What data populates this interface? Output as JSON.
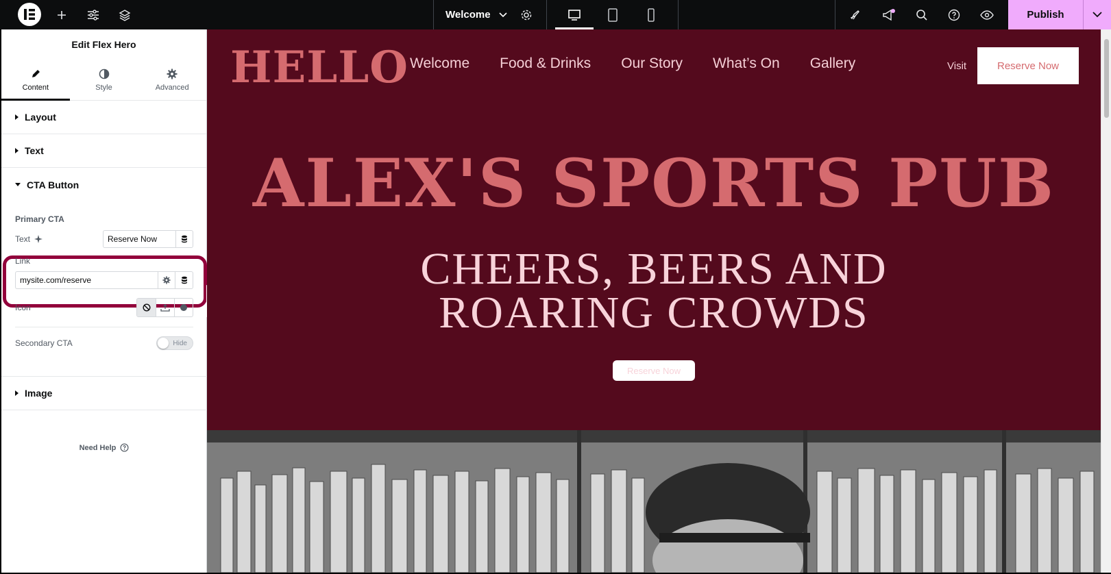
{
  "topbar": {
    "page_name": "Welcome",
    "publish_label": "Publish"
  },
  "panel": {
    "title": "Edit Flex Hero",
    "tabs": [
      {
        "label": "Content"
      },
      {
        "label": "Style"
      },
      {
        "label": "Advanced"
      }
    ],
    "sections": {
      "layout": "Layout",
      "text": "Text",
      "cta": "CTA Button",
      "image": "Image"
    },
    "primary_cta": {
      "heading": "Primary CTA",
      "text_label": "Text",
      "text_value": "Reserve Now",
      "link_label": "Link",
      "link_value": "mysite.com/reserve",
      "icon_label": "Icon"
    },
    "secondary_cta": {
      "label": "Secondary CTA",
      "toggle_label": "Hide"
    },
    "need_help": "Need Help"
  },
  "site": {
    "logo": "HELLO",
    "nav": [
      "Welcome",
      "Food & Drinks",
      "Our Story",
      "What’s On",
      "Gallery"
    ],
    "visit": "Visit",
    "reserve_top": "Reserve Now",
    "hero_title": "ALEX'S SPORTS PUB",
    "hero_subtitle": "CHEERS, BEERS AND ROARING CROWDS",
    "hero_button": "Reserve Now"
  },
  "colors": {
    "canvas_bg": "#540a1d",
    "accent_pink": "#d56b6f",
    "publish_bg": "#f0abfc",
    "highlight": "#92003b"
  }
}
